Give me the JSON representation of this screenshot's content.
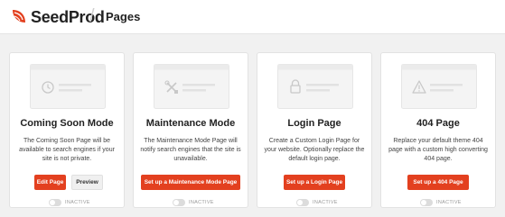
{
  "header": {
    "brand": "SeedProd",
    "page_title": "Pages"
  },
  "colors": {
    "accent": "#e3401f",
    "toggle_off": "#dcdcdc"
  },
  "cards": [
    {
      "title": "Coming Soon Mode",
      "icon": "clock-icon",
      "description": "The Coming Soon Page will be available to search engines if your site is not private.",
      "primary_button": "Edit Page",
      "secondary_button": "Preview",
      "status": "INACTIVE"
    },
    {
      "title": "Maintenance Mode",
      "icon": "tools-icon",
      "description": "The Maintenance Mode Page will notify search engines that the site is unavailable.",
      "primary_button": "Set up a Maintenance Mode Page",
      "status": "INACTIVE"
    },
    {
      "title": "Login Page",
      "icon": "lock-icon",
      "description": "Create a Custom Login Page for your website. Optionally replace the default login page.",
      "primary_button": "Set up a Login Page",
      "status": "INACTIVE"
    },
    {
      "title": "404 Page",
      "icon": "warning-icon",
      "description": "Replace your default theme 404 page with a custom high converting 404 page.",
      "primary_button": "Set up a 404 Page",
      "status": "INACTIVE"
    }
  ]
}
